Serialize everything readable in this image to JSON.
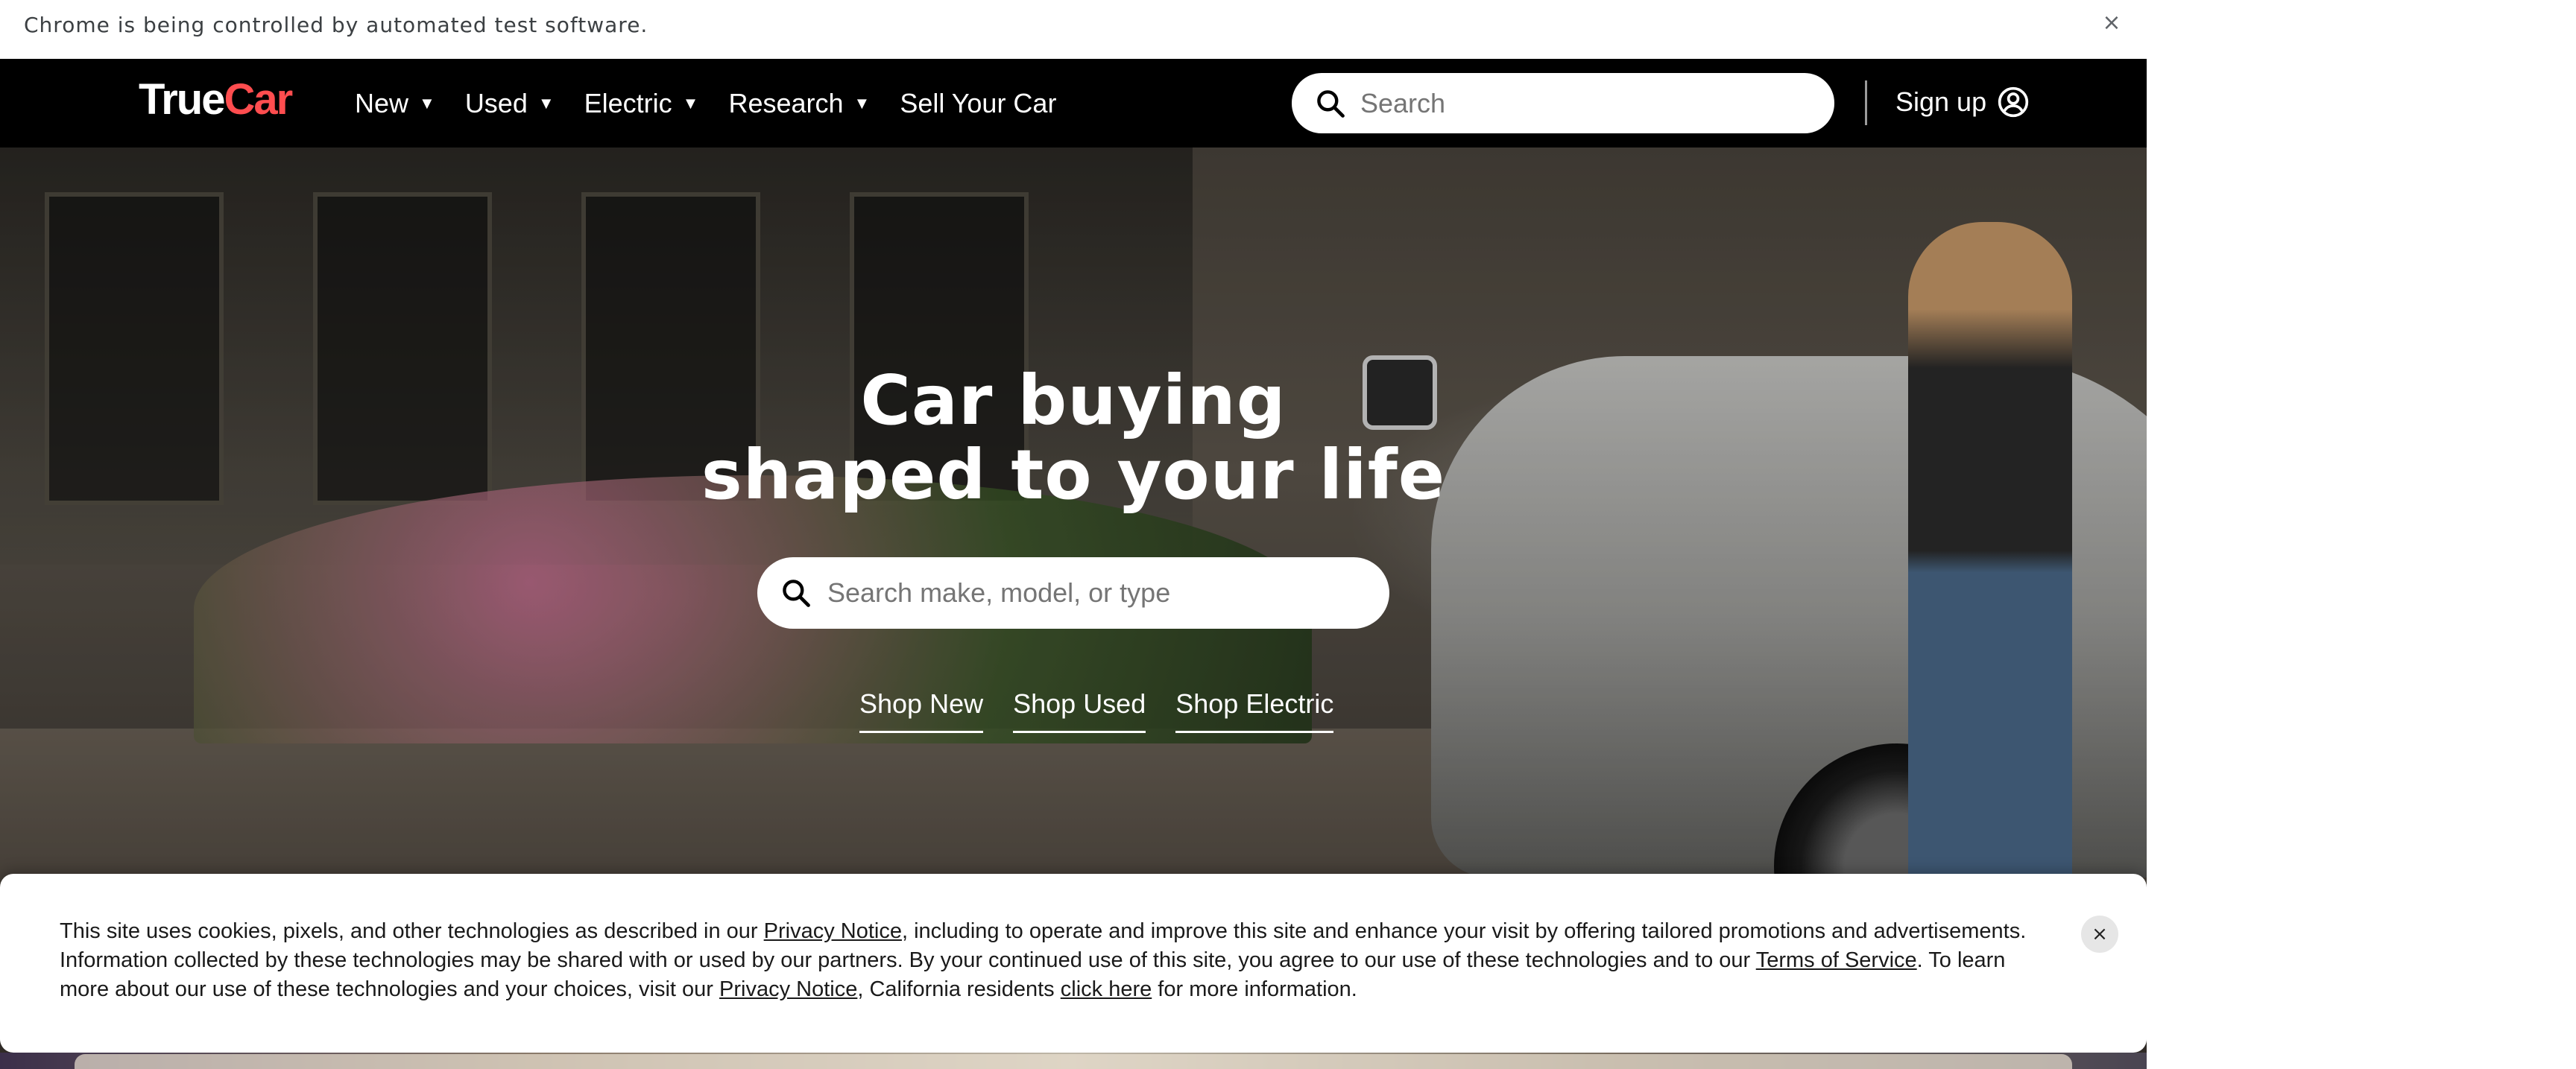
{
  "infobar": {
    "message": "Chrome is being controlled by automated test software.",
    "close_icon": "×"
  },
  "header": {
    "logo_true": "True",
    "logo_car": "Car",
    "nav": [
      {
        "label": "New"
      },
      {
        "label": "Used"
      },
      {
        "label": "Electric"
      },
      {
        "label": "Research"
      }
    ],
    "nav_caret": "▼",
    "sell_label": "Sell Your Car",
    "search_placeholder": "Search",
    "signup_label": "Sign up"
  },
  "hero": {
    "headline_line1": "Car buying",
    "headline_line2": "shaped to your life",
    "search_placeholder": "Search make, model, or type",
    "links": [
      {
        "label": "Shop New"
      },
      {
        "label": "Shop Used"
      },
      {
        "label": "Shop Electric"
      }
    ]
  },
  "cookie": {
    "text_1": "This site uses cookies, pixels, and other technologies as described in our ",
    "link_privacy_1": "Privacy Notice",
    "text_2": ", including to operate and improve this site and enhance your visit by offering tailored promotions and advertisements. Information collected by these technologies may be shared with or used by our partners. By your continued use of this site, you agree to our use of these technologies and to our ",
    "link_terms": "Terms of Service",
    "text_3": ". To learn more about our use of these technologies and your choices, visit our ",
    "link_privacy_2": "Privacy Notice",
    "text_4": ", California residents ",
    "link_click_here": "click here",
    "text_5": " for more information.",
    "close_icon": "×"
  },
  "colors": {
    "header_bg": "#000000",
    "logo_accent": "#ff4d4f",
    "banner_bg": "#ffffff"
  }
}
